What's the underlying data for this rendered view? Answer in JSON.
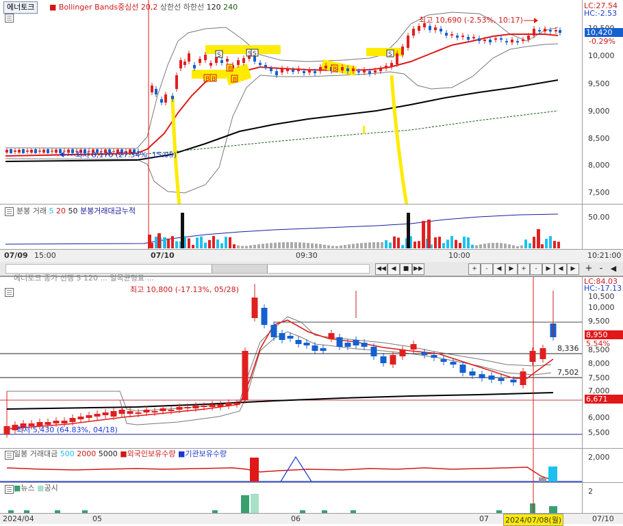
{
  "top_chart": {
    "stock_tab": "에너토크",
    "legend": {
      "indicator": "Bollinger Bands중심선",
      "period": "20,2",
      "upper": "상한선",
      "lower": "하한선",
      "ma1": "120",
      "ma2": "240"
    },
    "lc": "LC:27.54",
    "hc": "HC:-2.53",
    "high_annotation": "최고 10,690 (-2.53%, 10:17)",
    "low_annotation": "최저 8,170 (27.54%, 15:05)",
    "last_price": "10,420",
    "last_change": "-0.29%",
    "y_ticks": [
      "10,500",
      "10,000",
      "9,500",
      "9,000",
      "8,500",
      "8,000",
      "7,500"
    ],
    "signals": [
      "S",
      "S",
      "S",
      "S",
      "B",
      "B",
      "B",
      "B"
    ]
  },
  "volume_panel": {
    "label": "분봉 거래",
    "p1": "5",
    "p2": "20",
    "p3": "50",
    "cumulative": "분봉거래대금누적",
    "y_tick": "50.00"
  },
  "time_axis_top": {
    "labels": [
      "07/09",
      "15:00",
      "07/10",
      "09:30",
      "10:00"
    ],
    "right": "10:21:00"
  },
  "toolbar": {
    "buttons": [
      "◀◀",
      "◀",
      "■",
      "▶▶"
    ],
    "right": [
      "+",
      "-",
      "◀",
      "▶",
      "+",
      "-",
      "▶",
      "◀",
      "▶",
      "+",
      "-",
      "◀"
    ]
  },
  "bottom_chart": {
    "legend_fragment": "에너토크  종가 선행  5  120  ... 일목균형표 ...",
    "lc": "LC:84.03",
    "hc": "HC:-17.13",
    "high_annotation": "최고 10,800 (-17.13%, 05/28)",
    "low_annotation": "최저 5,430 (64.83%, 04/18)",
    "last_price": "8,950",
    "last_change": "5.54%",
    "level_8336": "8,336",
    "level_7502": "7,502",
    "level_6671": "6,671",
    "y_ticks": [
      "10,500",
      "10,000",
      "9,500",
      "9,000",
      "8,500",
      "8,000",
      "7,500",
      "7,000",
      "6,500",
      "6,000",
      "5,500"
    ]
  },
  "daily_volume_panel": {
    "label": "일봉 거래대금",
    "p1": "500",
    "p2": "2000",
    "p3": "5000",
    "foreign": "외국인보유수량",
    "institution": "기관보유수량",
    "y_tick": "2,000"
  },
  "news_panel": {
    "news": "뉴스",
    "disclosure": "공시",
    "y_tick": "2"
  },
  "time_axis_bottom": {
    "labels": [
      "2024/04",
      "05",
      "06",
      "07"
    ],
    "highlight": "2024/07/08(월)",
    "right": "07/10"
  },
  "colors": {
    "up": "#e02020",
    "down": "#1560d0",
    "ma": "#000000",
    "highlight": "#ffeb00",
    "vol_cyan": "#1ec0f0"
  }
}
